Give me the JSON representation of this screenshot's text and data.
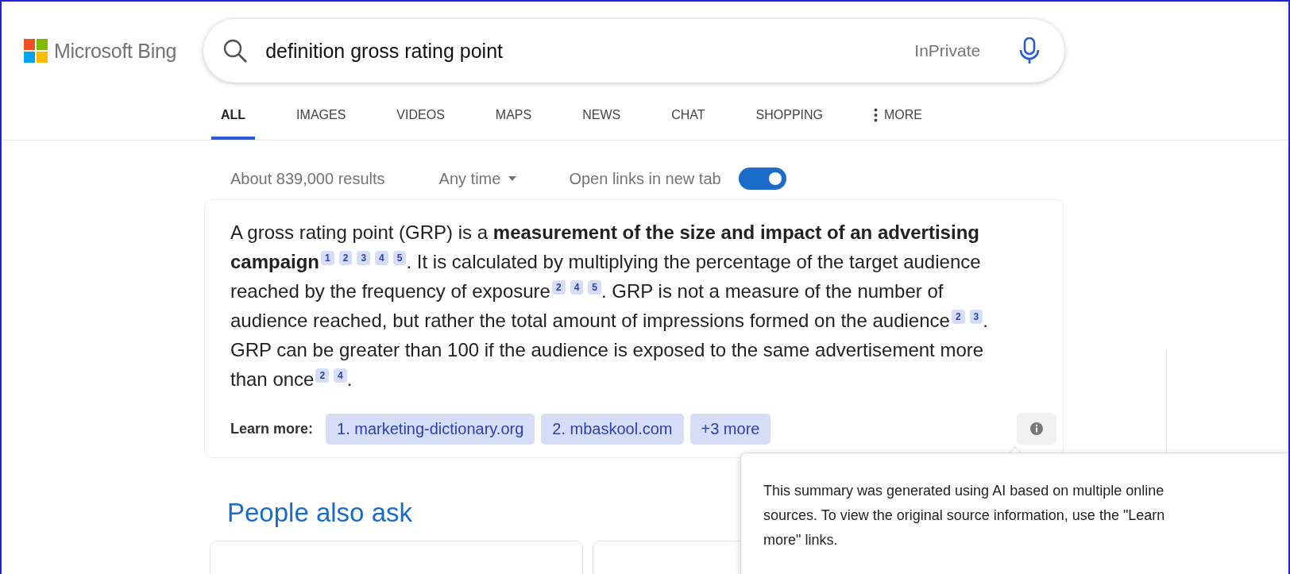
{
  "brand": {
    "name": "Microsoft Bing"
  },
  "search": {
    "value": "definition gross rating point",
    "mode": "InPrivate"
  },
  "tabs": [
    {
      "label": "ALL",
      "selected": true
    },
    {
      "label": "IMAGES",
      "selected": false
    },
    {
      "label": "VIDEOS",
      "selected": false
    },
    {
      "label": "MAPS",
      "selected": false
    },
    {
      "label": "NEWS",
      "selected": false
    },
    {
      "label": "CHAT",
      "selected": false
    },
    {
      "label": "SHOPPING",
      "selected": false
    },
    {
      "label": "MORE",
      "selected": false,
      "kind": "menu"
    }
  ],
  "results_bar": {
    "count": "About 839,000 results",
    "time_filter": "Any time",
    "new_tab_label": "Open links in new tab",
    "new_tab_on": true
  },
  "summary": {
    "segments": [
      {
        "text": "A gross rating point (GRP) is a **measurement of the size and impact of an advertising campaign**",
        "citations": [
          "1",
          "2",
          "3",
          "4",
          "5"
        ]
      },
      {
        "text": ". It is calculated by multiplying the percentage of the target audience reached by the frequency of exposure",
        "citations": [
          "2",
          "4",
          "5"
        ]
      },
      {
        "text": ". GRP is not a measure of the number of audience reached, but rather the total amount of impressions formed on the audience",
        "citations": [
          "2",
          "3"
        ]
      },
      {
        "text": ". GRP can be greater than 100 if the audience is exposed to the same advertisement more than once",
        "citations": [
          "2",
          "4"
        ]
      },
      {
        "text": "."
      }
    ],
    "learn_more_label": "Learn more:",
    "sources": [
      "1. marketing-dictionary.org",
      "2. mbaskool.com",
      "+3 more"
    ],
    "tooltip": "This summary was generated using AI based on multiple online sources. To view the original source information, use the \"Learn more\" links."
  },
  "people_also_ask": {
    "title": "People also ask"
  }
}
